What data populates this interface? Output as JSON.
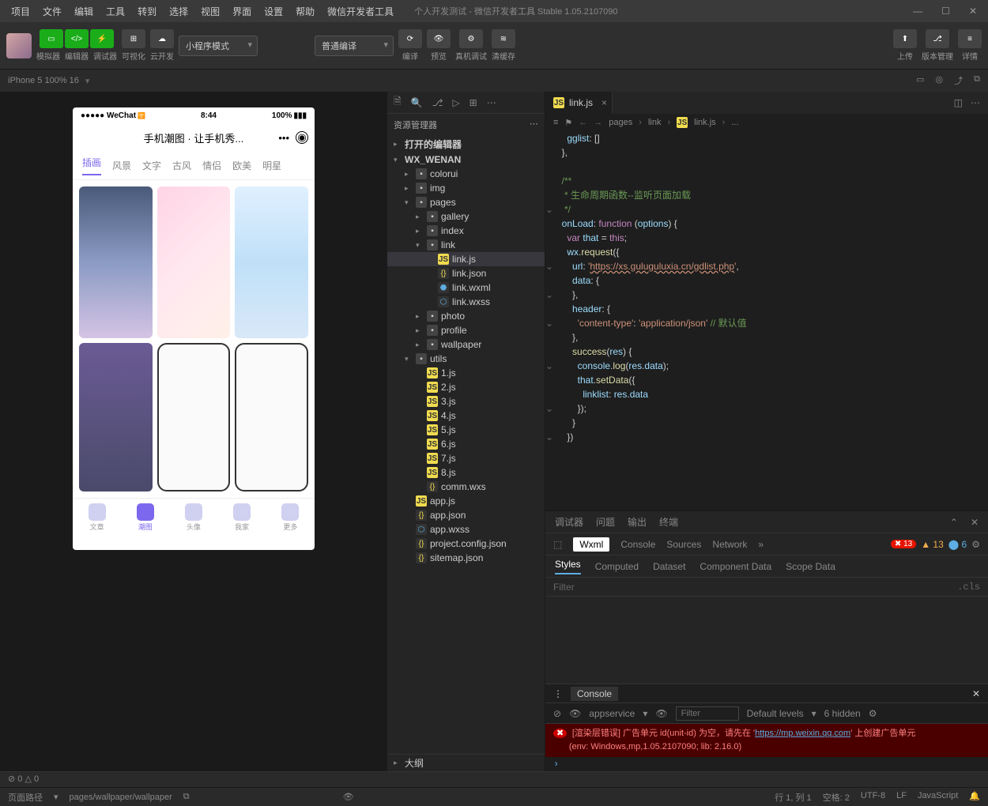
{
  "menu": [
    "项目",
    "文件",
    "编辑",
    "工具",
    "转到",
    "选择",
    "视图",
    "界面",
    "设置",
    "帮助",
    "微信开发者工具"
  ],
  "app_title": "个人开发测试 - 微信开发者工具 Stable 1.05.2107090",
  "toolbar": {
    "group1_labels": [
      "模拟器",
      "编辑器",
      "调试器"
    ],
    "vis_label": "可视化",
    "cloud_label": "云开发",
    "mode": "小程序模式",
    "compile": "普通编译",
    "actions": [
      "编译",
      "预览",
      "真机调试",
      "清缓存"
    ],
    "right": [
      "上传",
      "版本管理",
      "详情"
    ]
  },
  "device": {
    "name": "iPhone 5 100% 16"
  },
  "phone": {
    "carrier": "●●●●● WeChat",
    "signal": "",
    "time": "8:44",
    "batt": "100%",
    "title": "手机潮图 · 让手机秀...",
    "tabs": [
      "插画",
      "风景",
      "文字",
      "古风",
      "情侣",
      "欧美",
      "明星"
    ],
    "nav": [
      "文章",
      "潮图",
      "头像",
      "我家",
      "更多"
    ]
  },
  "explorer": {
    "title": "资源管理器",
    "open_editors": "打开的编辑器",
    "project": "WX_WENAN",
    "tree": [
      {
        "label": "colorui",
        "type": "folder",
        "depth": 1
      },
      {
        "label": "img",
        "type": "folder",
        "depth": 1,
        "ico": "img"
      },
      {
        "label": "pages",
        "type": "folder",
        "depth": 1,
        "open": true,
        "ico": "pages",
        "children": [
          {
            "label": "gallery",
            "type": "folder",
            "depth": 2
          },
          {
            "label": "index",
            "type": "folder",
            "depth": 2
          },
          {
            "label": "link",
            "type": "folder",
            "depth": 2,
            "open": true,
            "children": [
              {
                "label": "link.js",
                "type": "js",
                "depth": 3,
                "sel": true
              },
              {
                "label": "link.json",
                "type": "json",
                "depth": 3
              },
              {
                "label": "link.wxml",
                "type": "wxml",
                "depth": 3
              },
              {
                "label": "link.wxss",
                "type": "wxss",
                "depth": 3
              }
            ]
          },
          {
            "label": "photo",
            "type": "folder",
            "depth": 2
          },
          {
            "label": "profile",
            "type": "folder",
            "depth": 2
          },
          {
            "label": "wallpaper",
            "type": "folder",
            "depth": 2
          }
        ]
      },
      {
        "label": "utils",
        "type": "folder",
        "depth": 1,
        "open": true,
        "ico": "pages",
        "children": [
          {
            "label": "1.js",
            "type": "js",
            "depth": 2
          },
          {
            "label": "2.js",
            "type": "js",
            "depth": 2
          },
          {
            "label": "3.js",
            "type": "js",
            "depth": 2
          },
          {
            "label": "4.js",
            "type": "js",
            "depth": 2
          },
          {
            "label": "5.js",
            "type": "js",
            "depth": 2
          },
          {
            "label": "6.js",
            "type": "js",
            "depth": 2
          },
          {
            "label": "7.js",
            "type": "js",
            "depth": 2
          },
          {
            "label": "8.js",
            "type": "js",
            "depth": 2
          },
          {
            "label": "comm.wxs",
            "type": "json",
            "depth": 2
          }
        ]
      },
      {
        "label": "app.js",
        "type": "js",
        "depth": 1
      },
      {
        "label": "app.json",
        "type": "json",
        "depth": 1
      },
      {
        "label": "app.wxss",
        "type": "wxss",
        "depth": 1
      },
      {
        "label": "project.config.json",
        "type": "json",
        "depth": 1
      },
      {
        "label": "sitemap.json",
        "type": "json",
        "depth": 1
      }
    ],
    "outline": "大纲"
  },
  "editor": {
    "tab": "link.js",
    "crumbs": [
      "pages",
      "link",
      "link.js",
      "..."
    ],
    "code_url": "https://xs.guluguluxia.cn/gdlist.php",
    "comment": "生命周期函数--监听页面加载",
    "comment_tail": "// 默认值"
  },
  "debugger": {
    "tabs": [
      "调试器",
      "问题",
      "输出",
      "终端"
    ],
    "tools": [
      "Wxml",
      "Console",
      "Sources",
      "Network"
    ],
    "err_count": "13",
    "warn_count": "13",
    "info_count": "6",
    "style_tabs": [
      "Styles",
      "Computed",
      "Dataset",
      "Component Data",
      "Scope Data"
    ],
    "filter": "Filter",
    "cls": ".cls",
    "console_label": "Console",
    "appservice": "appservice",
    "filter2": "Filter",
    "levels": "Default levels",
    "hidden": "6 hidden",
    "err_line1": "[渲染层错误] 广告单元 id(unit-id) 为空，请先在 '",
    "err_url": "https://mp.weixin.qq.com",
    "err_line1b": "' 上创建广告单元",
    "err_line2": "(env: Windows,mp,1.05.2107090; lib: 2.16.0)"
  },
  "status": {
    "left1": "页面路径",
    "left2": "pages/wallpaper/wallpaper",
    "stats": "⊘ 0 △ 0",
    "right": [
      "行 1, 列 1",
      "空格: 2",
      "UTF-8",
      "LF",
      "JavaScript"
    ]
  }
}
